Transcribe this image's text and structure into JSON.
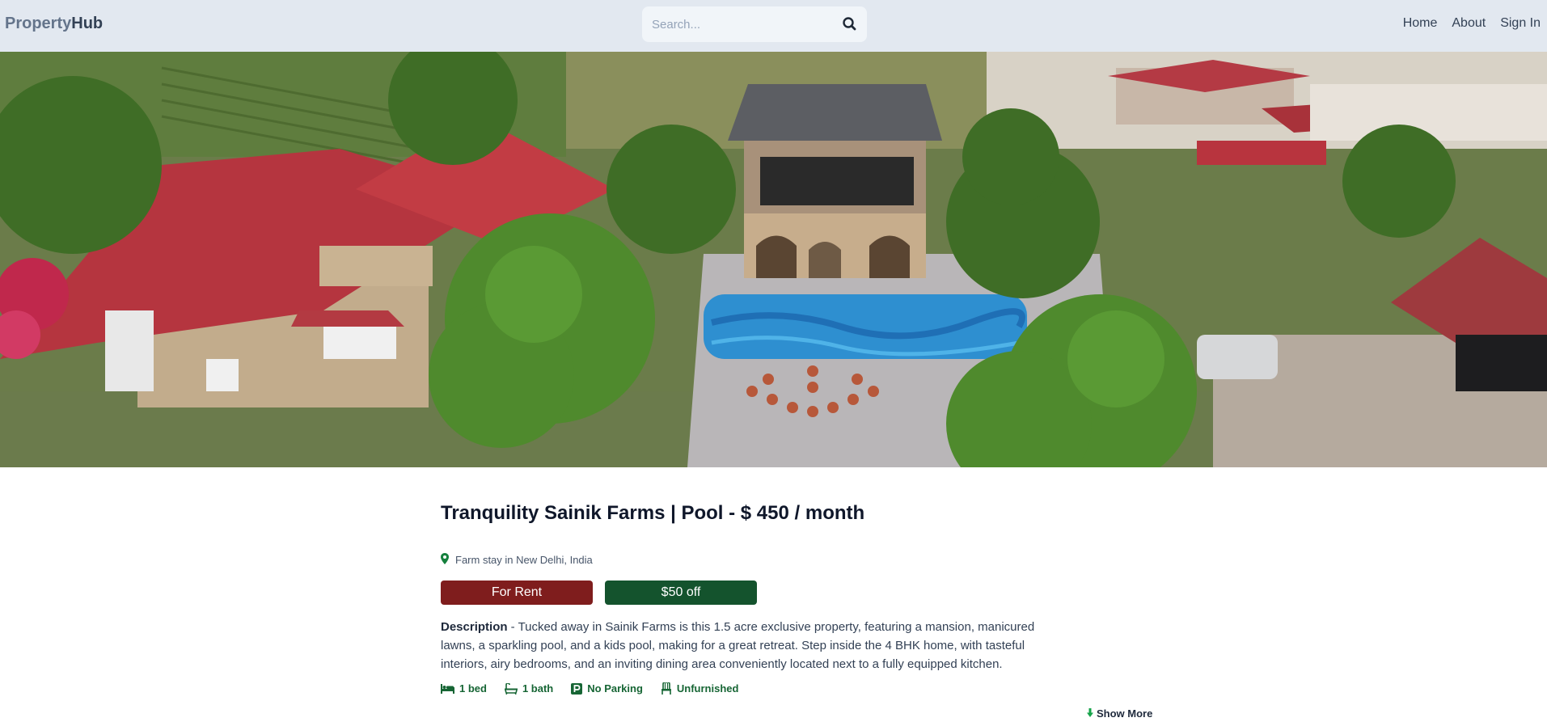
{
  "header": {
    "logo_part1": "Property",
    "logo_part2": "Hub",
    "search_placeholder": "Search...",
    "nav": [
      "Home",
      "About",
      "Sign In"
    ]
  },
  "hero": {
    "image_subject": "aerial photo of farmhouse with pool"
  },
  "listing": {
    "title": "Tranquility Sainik Farms | Pool - $ 450 / month",
    "location": "Farm stay in New Delhi, India",
    "type_badge": "For Rent",
    "discount_badge": "$50 off",
    "description_label": "Description",
    "description_text": " - Tucked away in Sainik Farms is this 1.5 acre exclusive property, featuring a mansion, manicured lawns, a sparkling pool, and a kids pool, making for a great retreat. Step inside the 4 BHK home, with tasteful interiors, airy bedrooms, and an inviting dining area conveniently located next to a fully equipped kitchen.",
    "features": {
      "beds": "1 bed",
      "baths": "1 bath",
      "parking": "No Parking",
      "furnished": "Unfurnished"
    },
    "more_link": "Show More"
  },
  "colors": {
    "header_bg": "#e2e8f0",
    "rent_badge": "#7f1d1d",
    "discount_badge": "#14532d",
    "feature_text": "#166534"
  }
}
